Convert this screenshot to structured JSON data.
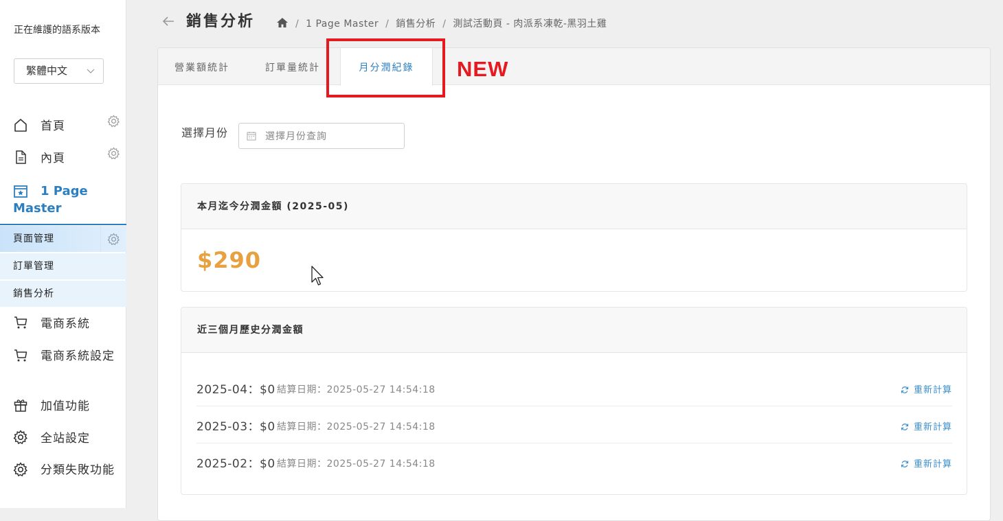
{
  "sidebar": {
    "lang_title": "正在維護的語系版本",
    "lang_value": "繁體中文",
    "items": [
      {
        "label": "首頁",
        "icon": "home-icon"
      },
      {
        "label": "內頁",
        "icon": "document-icon"
      }
    ],
    "active_section": {
      "label": "1 Page Master",
      "icon": "star-calendar-icon"
    },
    "sub_items": [
      {
        "label": "頁面管理"
      },
      {
        "label": "訂單管理"
      },
      {
        "label": "銷售分析"
      }
    ],
    "more_items": [
      {
        "label": "電商系統",
        "icon": "cart-icon"
      },
      {
        "label": "電商系統設定",
        "icon": "cart-icon"
      },
      {
        "label": "加值功能",
        "icon": "gift-icon"
      },
      {
        "label": "全站設定",
        "icon": "gear-icon"
      },
      {
        "label": "分類失敗功能",
        "icon": "gear-icon"
      }
    ]
  },
  "header": {
    "title": "銷售分析",
    "breadcrumb": [
      "1 Page Master",
      "銷售分析",
      "測試活動頁 - 肉派系凍乾-黑羽土雞"
    ]
  },
  "tabs": [
    {
      "label": "營業額統計"
    },
    {
      "label": "訂單量統計"
    },
    {
      "label": "月分潤紀錄"
    }
  ],
  "annotation": {
    "label": "NEW",
    "color": "#e5191f"
  },
  "filter": {
    "label": "選擇月份",
    "placeholder": "選擇月份查詢"
  },
  "current_card": {
    "title": "本月迄今分潤金額 (2025-05)",
    "amount": "$290"
  },
  "history_card": {
    "title": "近三個月歷史分潤金額",
    "rows": [
      {
        "month": "2025-04：$0",
        "settle": "結算日期：2025-05-27 14:54:18",
        "action": "重新計算"
      },
      {
        "month": "2025-03：$0",
        "settle": "結算日期：2025-05-27 14:54:18",
        "action": "重新計算"
      },
      {
        "month": "2025-02：$0",
        "settle": "結算日期：2025-05-27 14:54:18",
        "action": "重新計算"
      }
    ]
  },
  "colors": {
    "accent": "#2b7fc0",
    "amount": "#e8a140"
  }
}
